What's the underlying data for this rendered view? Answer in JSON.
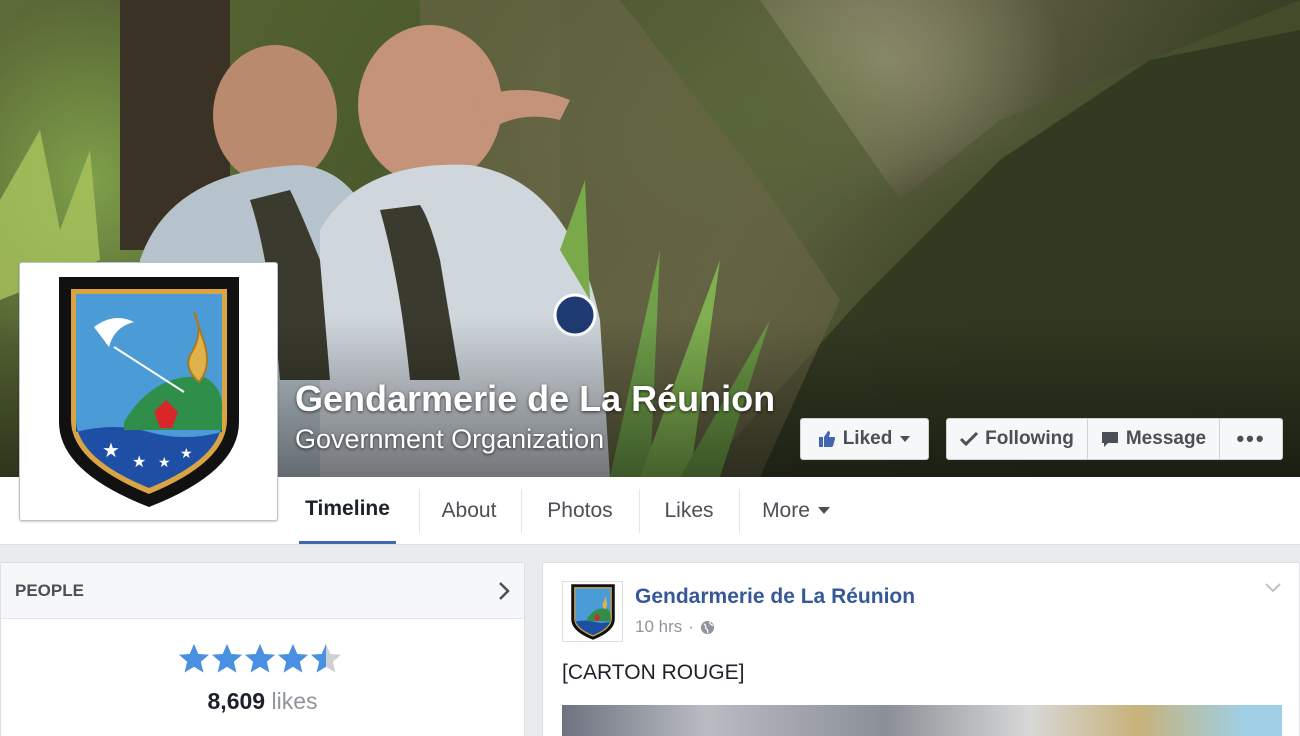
{
  "header": {
    "page_name": "Gendarmerie de La Réunion",
    "category": "Government Organization"
  },
  "actions": {
    "liked_label": "Liked",
    "following_label": "Following",
    "message_label": "Message",
    "more_label": "•••"
  },
  "nav": {
    "tabs": [
      {
        "label": "Timeline",
        "active": true
      },
      {
        "label": "About"
      },
      {
        "label": "Photos"
      },
      {
        "label": "Likes"
      },
      {
        "label": "More"
      }
    ]
  },
  "people": {
    "title": "PEOPLE",
    "rating": 4.5,
    "rating_max": 5,
    "likes_count": "8,609",
    "likes_word": "likes"
  },
  "post": {
    "author": "Gendarmerie de La Réunion",
    "time": "10 hrs",
    "separator": "·",
    "text": "[CARTON ROUGE]"
  },
  "colors": {
    "link_blue": "#365899",
    "accent_blue": "#4267b2",
    "star_blue": "#4a90e2"
  }
}
